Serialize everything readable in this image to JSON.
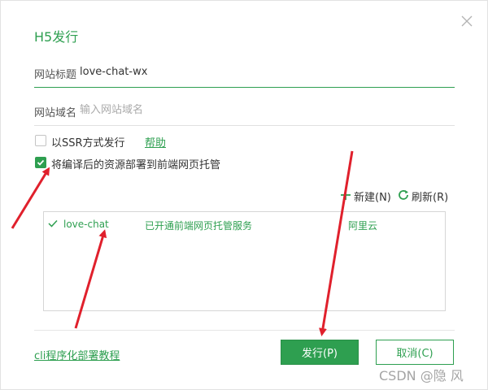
{
  "dialog": {
    "title": "H5发行"
  },
  "fields": {
    "site_title": {
      "label": "网站标题",
      "value": "love-chat-wx"
    },
    "site_domain": {
      "label": "网站域名",
      "placeholder": "输入网站域名"
    }
  },
  "options": {
    "ssr": {
      "label": "以SSR方式发行",
      "help": "帮助",
      "checked": false
    },
    "host": {
      "label": "将编译后的资源部署到前端网页托管",
      "checked": true
    }
  },
  "toolbar": {
    "new_label": "新建(N)",
    "refresh_label": "刷新(R)"
  },
  "hosting_list": [
    {
      "name": "love-chat",
      "status": "已开通前端网页托管服务",
      "provider": "阿里云",
      "selected": true
    }
  ],
  "footer": {
    "cli_link": "cli程序化部署教程",
    "publish_button": "发行(P)",
    "cancel_button": "取消(C)"
  },
  "watermark": "CSDN @隐 风",
  "colors": {
    "accent": "#2e9f50",
    "annotation_arrow": "#e0202c"
  }
}
